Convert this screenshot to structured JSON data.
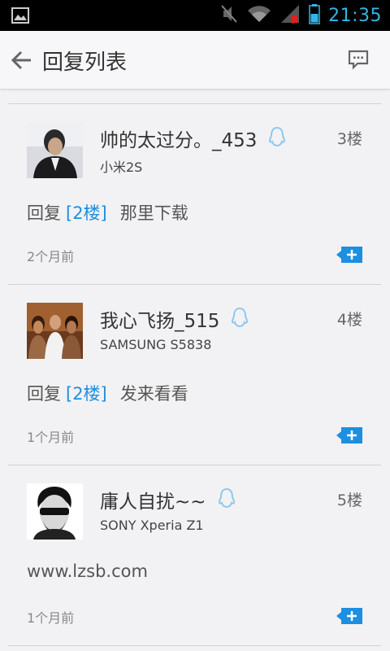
{
  "status_bar": {
    "time": "21:35",
    "icons": [
      "image-icon",
      "mute-icon",
      "wifi-icon",
      "signal-icon",
      "battery-icon"
    ]
  },
  "header": {
    "title": "回复列表",
    "back_icon": "arrow-left-icon",
    "action_icon": "message-bubble-icon"
  },
  "replies": [
    {
      "username": "帅的太过分。_453",
      "device": "小米2S",
      "floor": "3楼",
      "reply_prefix": "回复",
      "reply_floor": "[2楼]",
      "content": "那里下载",
      "time": "2个月前"
    },
    {
      "username": "我心飞扬_515",
      "device": "SAMSUNG S5838",
      "floor": "4楼",
      "reply_prefix": "回复",
      "reply_floor": "[2楼]",
      "content": "发来看看",
      "time": "1个月前"
    },
    {
      "username": "庸人自扰~~",
      "device": "SONY Xperia Z1",
      "floor": "5楼",
      "content": "www.lzsb.com",
      "time": "1个月前"
    }
  ],
  "colors": {
    "accent": "#1e8fe0",
    "status_text": "#33b5e5",
    "background": "#f2f2f4"
  }
}
